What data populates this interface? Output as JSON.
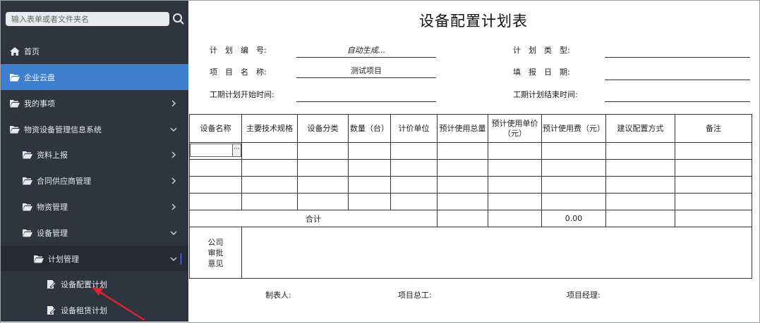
{
  "search": {
    "placeholder": "输入表单或者文件夹名"
  },
  "sidebar": {
    "items": [
      {
        "label": "首页",
        "icon": "home-icon"
      },
      {
        "label": "企业云盘",
        "icon": "folder-open-icon"
      },
      {
        "label": "我的事项",
        "icon": "folder-open-icon"
      },
      {
        "label": "物资设备管理信息系统",
        "icon": "folder-open-icon"
      },
      {
        "label": "资料上报",
        "icon": "folder-open-icon"
      },
      {
        "label": "合同供应商管理",
        "icon": "folder-open-icon"
      },
      {
        "label": "物资管理",
        "icon": "folder-open-icon"
      },
      {
        "label": "设备管理",
        "icon": "folder-open-icon"
      },
      {
        "label": "计划管理",
        "icon": "folder-open-icon"
      },
      {
        "label": "设备配置计划",
        "icon": "document-edit-icon"
      },
      {
        "label": "设备租赁计划",
        "icon": "document-edit-icon"
      }
    ]
  },
  "form": {
    "title": "设备配置计划表",
    "fields": {
      "plan_no_label": "计　划　编　号:",
      "plan_no_value": "自动生成...",
      "plan_type_label": "计　划　类　型:",
      "plan_type_value": "",
      "project_name_label": "项　目　名　称:",
      "project_name_value": "测试项目",
      "fill_date_label": "填　报　日　期:",
      "fill_date_value": "",
      "start_label": "工期计划开始时间:",
      "start_value": "",
      "end_label": "工期计划结束时间:",
      "end_value": ""
    },
    "columns": [
      "设备名称",
      "主要技术规格",
      "设备分类",
      "数量（台）",
      "计价单位",
      "预计使用总量",
      "预计使用单价（元）",
      "预计使用费（元）",
      "建议配置方式",
      "备注"
    ],
    "sum_label": "合计",
    "sum_value": "0.00",
    "approval_label": "公司\n审批\n意见",
    "footer": {
      "maker": "制表人:",
      "chief": "项目总工:",
      "manager": "项目经理:"
    },
    "editor_button": "···"
  }
}
